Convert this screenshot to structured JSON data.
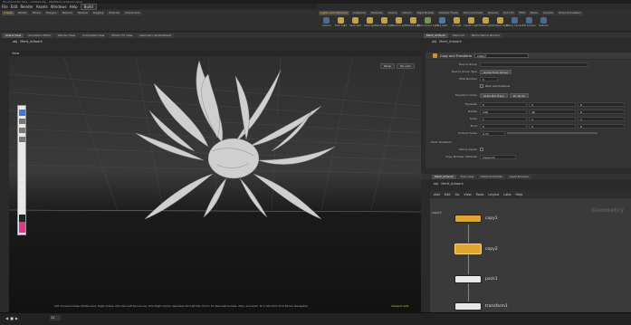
{
  "titlebar": "Houdini Indie 19.0 - untitled.hip - /obj/Merit_Artwork/copy2",
  "menu": [
    "File",
    "Edit",
    "Render",
    "Assets",
    "Windows",
    "Help"
  ],
  "build_label": "Build",
  "shelf_tabs_left": [
    "Create",
    "Modify",
    "Model",
    "Polygon",
    "Deform",
    "Texture",
    "Rigging",
    "Muscles",
    "Characters"
  ],
  "shelf_tabs_right": [
    "Lights and Cameras",
    "Collisions",
    "Particles",
    "Grains",
    "Vellum",
    "Rigid Bodies",
    "Particle Fluids",
    "Viscous Fluids",
    "Oceans",
    "Pyro FX",
    "FEM",
    "Wires",
    "Crowds",
    "Drive Simulation"
  ],
  "shelf_tools_right": [
    "Camera",
    "Point Light",
    "Spot Light",
    "Area Light",
    "Geometry Light",
    "Volume Light",
    "Distant Light",
    "Environment Light",
    "Sky Light",
    "GI Light",
    "Caustic Light",
    "Portal Light",
    "Ambient Light",
    "Stereo Camera",
    "VR Camera",
    "Switcher"
  ],
  "pane_tabs_left": [
    "Scene View",
    "Animation Editor",
    "Render View",
    "Composite View",
    "Motion FX View",
    "Geometry Spreadsheet"
  ],
  "path_left": [
    "obj",
    "Merit_Artwork"
  ],
  "viewport": {
    "view_label": "View",
    "cam_persp": "Persp",
    "cam_none": "No cam"
  },
  "status_msg": "Left mouse tumbles. Middle pans. Right dollies. Ctrl+Alt+Left box-zooms. Ctrl+Right zooms. Spacebar-Ctrl-Left tilts. Hold L for alternate tumble, dolly, and zoom.   M or Alt+M for First Person Navigation.",
  "status_right": "Viewport Safe",
  "frame": "12",
  "right_tabs_top": [
    "Merit_Artwork",
    "Take List",
    "Performance Monitor"
  ],
  "right_path_top": [
    "obj",
    "Merit_Artwork"
  ],
  "params": {
    "node_type": "Copy and Transform",
    "node_name": "copy2",
    "source_group_label": "Source Group",
    "group_type_label": "Source Group Type",
    "group_type_value": "Guess from Group",
    "total_number_label": "Total Number",
    "total_number_value": "5",
    "pack_label": "Pack and Instance",
    "transform_order_label": "Transform Order",
    "transform_order_value": "Scale Rot Trans",
    "rotate_order_value": "Rx Ry Rz",
    "rows": [
      {
        "label": "Translate",
        "v": [
          "0",
          "0",
          "0"
        ]
      },
      {
        "label": "Rotate",
        "v": [
          "148",
          "49",
          "0"
        ]
      },
      {
        "label": "Scale",
        "v": [
          "1",
          "1",
          "1"
        ]
      },
      {
        "label": "Pivot",
        "v": [
          "0",
          "0",
          "0"
        ]
      },
      {
        "label": "Uniform Scale",
        "v": [
          "0.75"
        ]
      }
    ],
    "pivot_xform_label": "Pivot Transform",
    "attrib_label": "Stamp Inputs",
    "copy_number_label": "Copy Number Attribute",
    "copy_number_value": "copynum"
  },
  "net_tabs": [
    "Merit_Artwork",
    "Tree View",
    "Material Palette",
    "Asset Browser"
  ],
  "net_path": [
    "obj",
    "Merit_Artwork"
  ],
  "net_menu": [
    "Add",
    "Edit",
    "Go",
    "View",
    "Tools",
    "Layout",
    "Labs",
    "Help"
  ],
  "geometry_label": "Geometry",
  "nodes": [
    {
      "name": "copy1",
      "color": "#e0a530"
    },
    {
      "name": "copy2",
      "color": "#e0a530"
    },
    {
      "name": "pack1",
      "color": "#e8e8e8"
    },
    {
      "name": "transform1",
      "color": "#e8e8e8"
    }
  ],
  "net_side_label": "copy3"
}
